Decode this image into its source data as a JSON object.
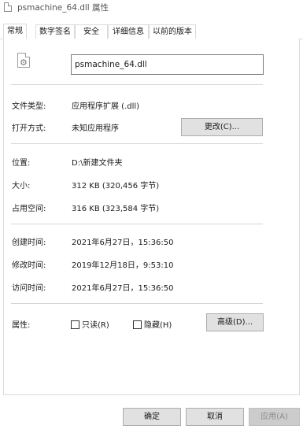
{
  "window": {
    "title": "psmachine_64.dll 属性"
  },
  "tabs": [
    {
      "label": "常规"
    },
    {
      "label": "数字签名"
    },
    {
      "label": "安全"
    },
    {
      "label": "详细信息"
    },
    {
      "label": "以前的版本"
    }
  ],
  "general": {
    "file_name": "psmachine_64.dll",
    "icon": "dll-file-gear-icon",
    "file_type": {
      "label": "文件类型:",
      "value": "应用程序扩展 (.dll)"
    },
    "opens_with": {
      "label": "打开方式:",
      "value": "未知应用程序",
      "change_button": "更改(C)..."
    },
    "location": {
      "label": "位置:",
      "value": "D:\\新建文件夹"
    },
    "size": {
      "label": "大小:",
      "value": "312 KB (320,456 字节)"
    },
    "size_on_disk": {
      "label": "占用空间:",
      "value": "316 KB (323,584 字节)"
    },
    "created": {
      "label": "创建时间:",
      "value": "2021年6月27日，15:36:50"
    },
    "modified": {
      "label": "修改时间:",
      "value": "2019年12月18日，9:53:10"
    },
    "accessed": {
      "label": "访问时间:",
      "value": "2021年6月27日，15:36:50"
    },
    "attributes": {
      "label": "属性:",
      "readonly": {
        "label": "只读(R)",
        "checked": false
      },
      "hidden": {
        "label": "隐藏(H)",
        "checked": false
      },
      "advanced_button": "高级(D)..."
    }
  },
  "footer": {
    "ok": "确定",
    "cancel": "取消",
    "apply": "应用(A)"
  }
}
